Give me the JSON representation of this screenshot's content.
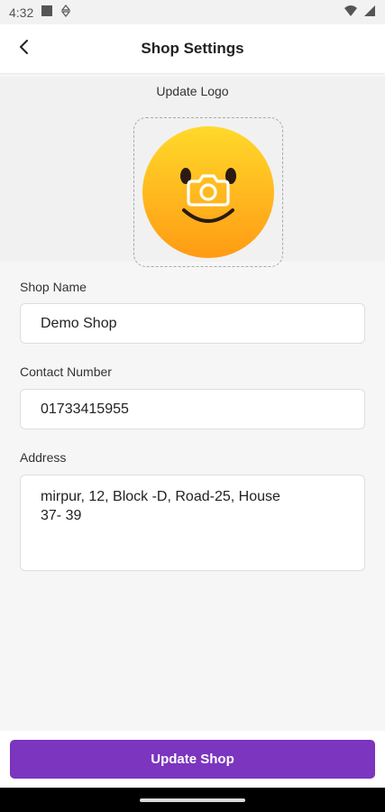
{
  "status_bar": {
    "time": "4:32",
    "icons": [
      "notification-square-icon",
      "data-saver-icon",
      "wifi-icon",
      "signal-icon"
    ]
  },
  "header": {
    "title": "Shop Settings",
    "back_icon": "chevron-left-icon"
  },
  "logo": {
    "label": "Update Logo",
    "image": "smiley-face-logo",
    "overlay_icon": "camera-icon"
  },
  "form": {
    "shop_name": {
      "label": "Shop Name",
      "value": "Demo Shop"
    },
    "contact_number": {
      "label": "Contact Number",
      "value": "01733415955"
    },
    "address": {
      "label": "Address",
      "value": "mirpur, 12, Block -D, Road-25, House 37- 39"
    }
  },
  "actions": {
    "submit_label": "Update Shop"
  },
  "colors": {
    "primary": "#7b35be",
    "background": "#f6f6f6",
    "app_bar": "#ffffff",
    "logo_yellow": "#ffd21f",
    "logo_orange": "#ff9a14"
  }
}
